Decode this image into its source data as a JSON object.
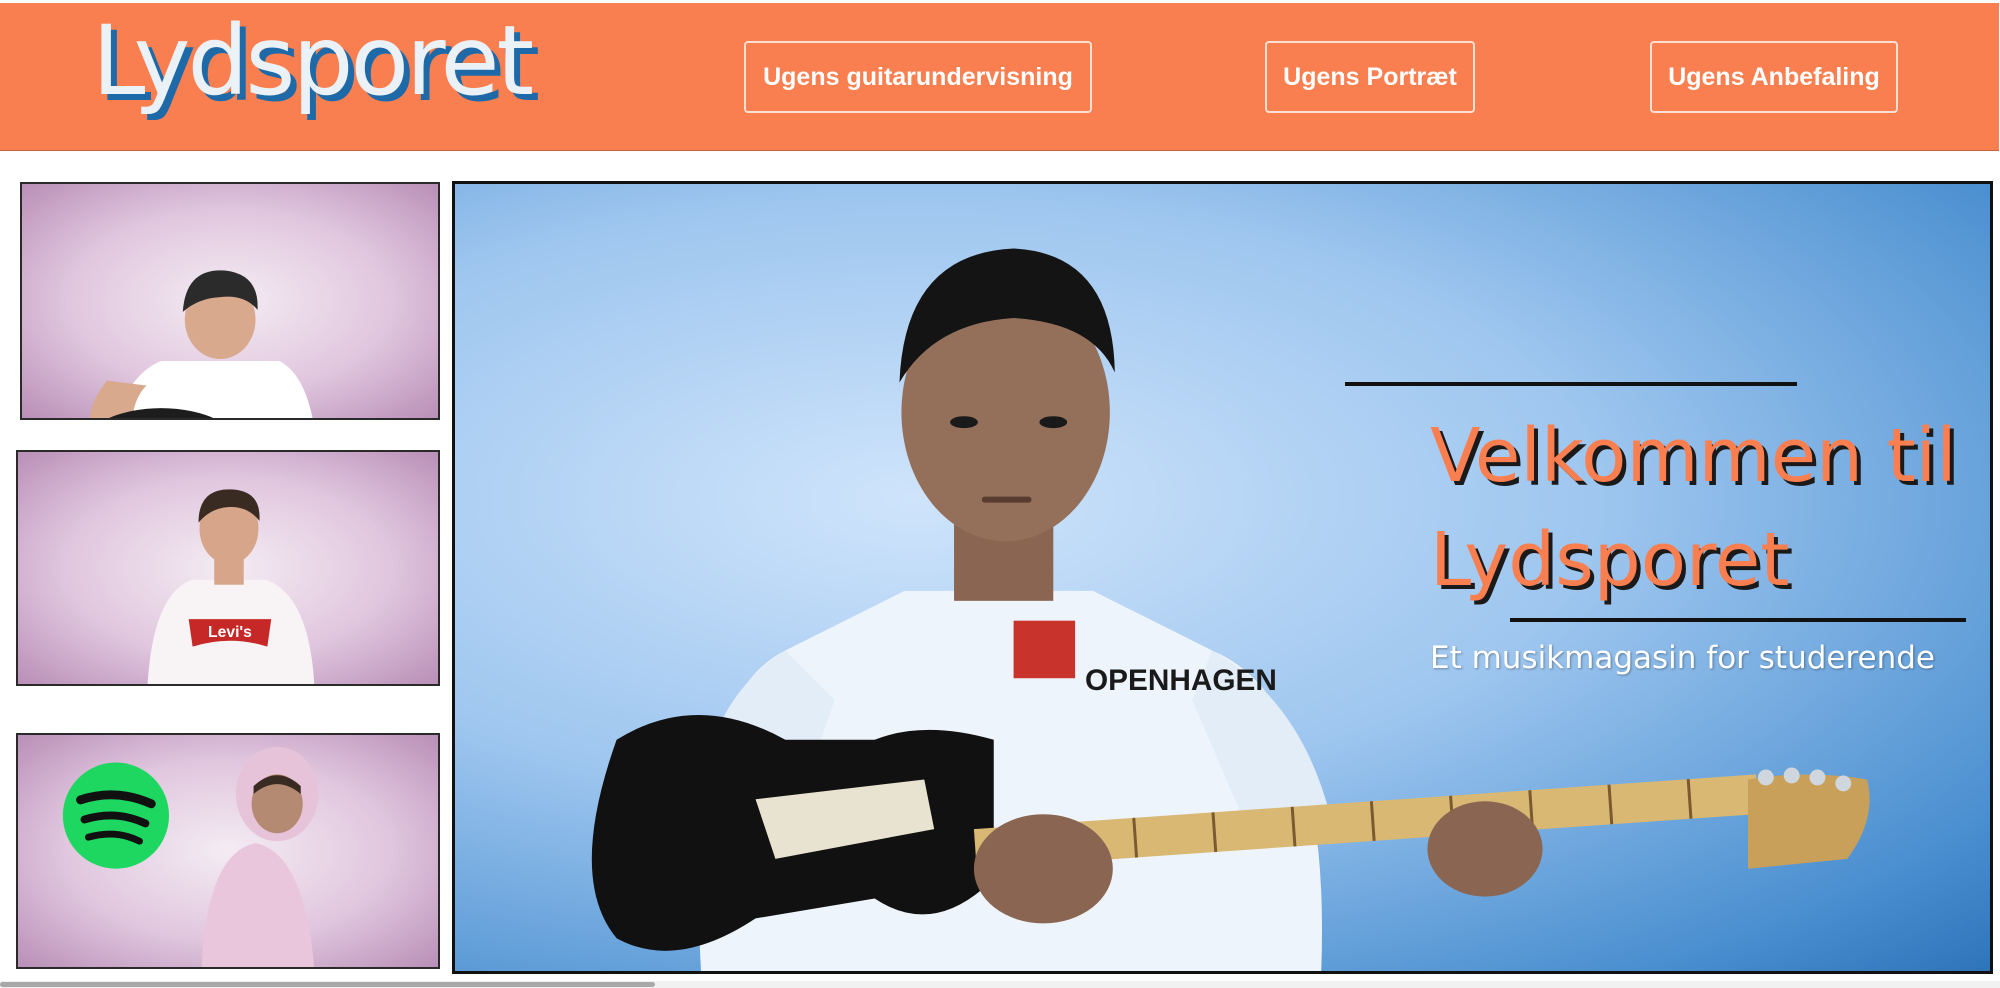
{
  "header": {
    "logo_text": "Lydsporet",
    "nav": [
      {
        "label": "Ugens guitarundervisning"
      },
      {
        "label": "Ugens Portræt"
      },
      {
        "label": "Ugens Anbefaling"
      }
    ]
  },
  "thumbnails": [
    {
      "description_icon": "guitar-player-photo"
    },
    {
      "description_icon": "portrait-photo",
      "shirt_text": "Levi's"
    },
    {
      "description_icon": "spotify-recommendation-photo"
    }
  ],
  "hero": {
    "title": "Velkommen til Lydsporet",
    "subtitle": "Et musikmagasin for studerende",
    "shirt_text": "OPENHAGEN"
  },
  "colors": {
    "brand_orange": "#fa7f50",
    "logo_blue": "#1e6aa8",
    "spotify_green": "#1ed760"
  }
}
